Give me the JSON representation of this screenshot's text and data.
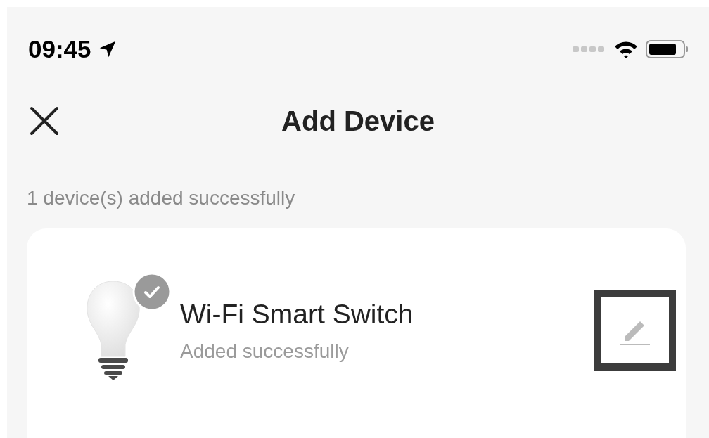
{
  "status_bar": {
    "time": "09:45"
  },
  "header": {
    "title": "Add Device"
  },
  "summary": "1 device(s) added successfully",
  "devices": [
    {
      "name": "Wi-Fi Smart Switch",
      "status": "Added successfully",
      "added": true
    }
  ]
}
